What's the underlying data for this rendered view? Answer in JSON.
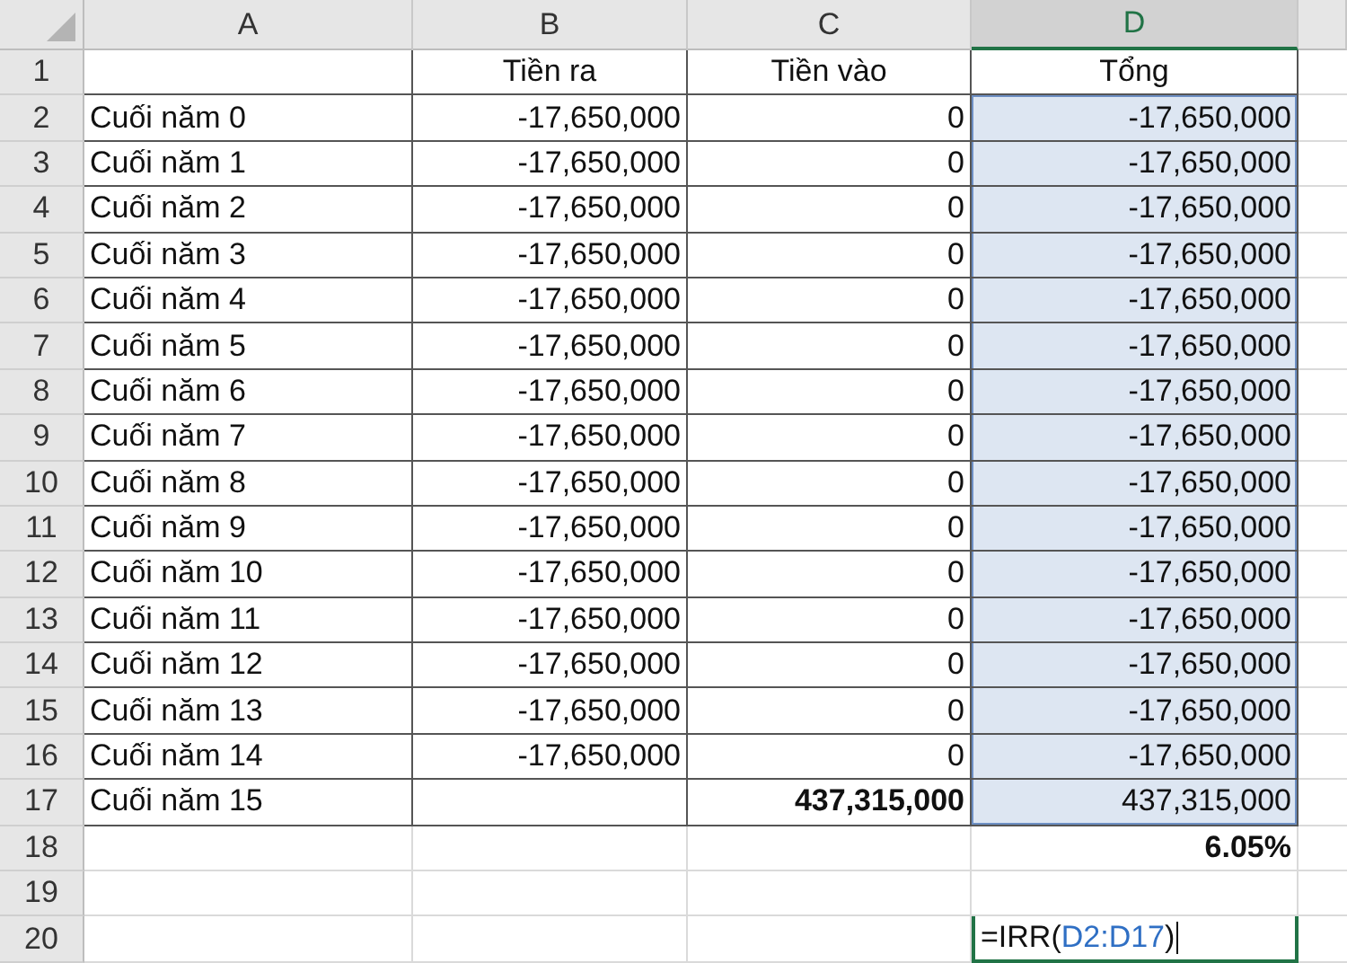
{
  "columns": [
    {
      "label": "A",
      "selected": false
    },
    {
      "label": "B",
      "selected": false
    },
    {
      "label": "C",
      "selected": false
    },
    {
      "label": "D",
      "selected": true
    }
  ],
  "rows": [
    {
      "number": "1",
      "bordered": true,
      "cells": {
        "B": {
          "text": "Tiền ra",
          "kind": "heading"
        },
        "C": {
          "text": "Tiền vào",
          "kind": "heading"
        },
        "D": {
          "text": "Tổng",
          "kind": "heading"
        }
      }
    },
    {
      "number": "2",
      "bordered": true,
      "cells": {
        "A": {
          "text": "Cuối năm 0",
          "kind": "text"
        },
        "B": {
          "text": "-17,650,000",
          "kind": "number"
        },
        "C": {
          "text": "0",
          "kind": "number"
        },
        "D": {
          "text": "-17,650,000",
          "kind": "number",
          "highlighted": true
        }
      }
    },
    {
      "number": "3",
      "bordered": true,
      "cells": {
        "A": {
          "text": "Cuối năm 1",
          "kind": "text"
        },
        "B": {
          "text": "-17,650,000",
          "kind": "number"
        },
        "C": {
          "text": "0",
          "kind": "number"
        },
        "D": {
          "text": "-17,650,000",
          "kind": "number",
          "highlighted": true
        }
      }
    },
    {
      "number": "4",
      "bordered": true,
      "cells": {
        "A": {
          "text": "Cuối năm 2",
          "kind": "text"
        },
        "B": {
          "text": "-17,650,000",
          "kind": "number"
        },
        "C": {
          "text": "0",
          "kind": "number"
        },
        "D": {
          "text": "-17,650,000",
          "kind": "number",
          "highlighted": true
        }
      }
    },
    {
      "number": "5",
      "bordered": true,
      "cells": {
        "A": {
          "text": "Cuối năm 3",
          "kind": "text"
        },
        "B": {
          "text": "-17,650,000",
          "kind": "number"
        },
        "C": {
          "text": "0",
          "kind": "number"
        },
        "D": {
          "text": "-17,650,000",
          "kind": "number",
          "highlighted": true
        }
      }
    },
    {
      "number": "6",
      "bordered": true,
      "cells": {
        "A": {
          "text": "Cuối năm 4",
          "kind": "text"
        },
        "B": {
          "text": "-17,650,000",
          "kind": "number"
        },
        "C": {
          "text": "0",
          "kind": "number"
        },
        "D": {
          "text": "-17,650,000",
          "kind": "number",
          "highlighted": true
        }
      }
    },
    {
      "number": "7",
      "bordered": true,
      "cells": {
        "A": {
          "text": "Cuối năm 5",
          "kind": "text"
        },
        "B": {
          "text": "-17,650,000",
          "kind": "number"
        },
        "C": {
          "text": "0",
          "kind": "number"
        },
        "D": {
          "text": "-17,650,000",
          "kind": "number",
          "highlighted": true
        }
      }
    },
    {
      "number": "8",
      "bordered": true,
      "cells": {
        "A": {
          "text": "Cuối năm 6",
          "kind": "text"
        },
        "B": {
          "text": "-17,650,000",
          "kind": "number"
        },
        "C": {
          "text": "0",
          "kind": "number"
        },
        "D": {
          "text": "-17,650,000",
          "kind": "number",
          "highlighted": true
        }
      }
    },
    {
      "number": "9",
      "bordered": true,
      "cells": {
        "A": {
          "text": "Cuối năm 7",
          "kind": "text"
        },
        "B": {
          "text": "-17,650,000",
          "kind": "number"
        },
        "C": {
          "text": "0",
          "kind": "number"
        },
        "D": {
          "text": "-17,650,000",
          "kind": "number",
          "highlighted": true
        }
      }
    },
    {
      "number": "10",
      "bordered": true,
      "cells": {
        "A": {
          "text": "Cuối năm 8",
          "kind": "text"
        },
        "B": {
          "text": "-17,650,000",
          "kind": "number"
        },
        "C": {
          "text": "0",
          "kind": "number"
        },
        "D": {
          "text": "-17,650,000",
          "kind": "number",
          "highlighted": true
        }
      }
    },
    {
      "number": "11",
      "bordered": true,
      "cells": {
        "A": {
          "text": "Cuối năm 9",
          "kind": "text"
        },
        "B": {
          "text": "-17,650,000",
          "kind": "number"
        },
        "C": {
          "text": "0",
          "kind": "number"
        },
        "D": {
          "text": "-17,650,000",
          "kind": "number",
          "highlighted": true
        }
      }
    },
    {
      "number": "12",
      "bordered": true,
      "cells": {
        "A": {
          "text": "Cuối năm 10",
          "kind": "text"
        },
        "B": {
          "text": "-17,650,000",
          "kind": "number"
        },
        "C": {
          "text": "0",
          "kind": "number"
        },
        "D": {
          "text": "-17,650,000",
          "kind": "number",
          "highlighted": true
        }
      }
    },
    {
      "number": "13",
      "bordered": true,
      "cells": {
        "A": {
          "text": "Cuối năm 11",
          "kind": "text"
        },
        "B": {
          "text": "-17,650,000",
          "kind": "number"
        },
        "C": {
          "text": "0",
          "kind": "number"
        },
        "D": {
          "text": "-17,650,000",
          "kind": "number",
          "highlighted": true
        }
      }
    },
    {
      "number": "14",
      "bordered": true,
      "cells": {
        "A": {
          "text": "Cuối năm 12",
          "kind": "text"
        },
        "B": {
          "text": "-17,650,000",
          "kind": "number"
        },
        "C": {
          "text": "0",
          "kind": "number"
        },
        "D": {
          "text": "-17,650,000",
          "kind": "number",
          "highlighted": true
        }
      }
    },
    {
      "number": "15",
      "bordered": true,
      "cells": {
        "A": {
          "text": "Cuối năm 13",
          "kind": "text"
        },
        "B": {
          "text": "-17,650,000",
          "kind": "number"
        },
        "C": {
          "text": "0",
          "kind": "number"
        },
        "D": {
          "text": "-17,650,000",
          "kind": "number",
          "highlighted": true
        }
      }
    },
    {
      "number": "16",
      "bordered": true,
      "cells": {
        "A": {
          "text": "Cuối năm 14",
          "kind": "text"
        },
        "B": {
          "text": "-17,650,000",
          "kind": "number"
        },
        "C": {
          "text": "0",
          "kind": "number"
        },
        "D": {
          "text": "-17,650,000",
          "kind": "number",
          "highlighted": true
        }
      }
    },
    {
      "number": "17",
      "bordered": true,
      "cells": {
        "A": {
          "text": "Cuối năm 15",
          "kind": "text"
        },
        "C": {
          "text": "437,315,000",
          "kind": "number",
          "bold": true
        },
        "D": {
          "text": "437,315,000",
          "kind": "number",
          "highlighted": true
        }
      }
    },
    {
      "number": "18",
      "bordered": false,
      "cells": {
        "D": {
          "text": "6.05%",
          "kind": "number",
          "bold": true
        }
      }
    },
    {
      "number": "19",
      "bordered": false,
      "cells": {}
    },
    {
      "number": "20",
      "bordered": false,
      "cells": {
        "D": {
          "kind": "formula",
          "parts": [
            {
              "text": "=IRR(",
              "kind": "plain"
            },
            {
              "text": "D2:D17",
              "kind": "reference"
            },
            {
              "text": ")",
              "kind": "plain"
            }
          ]
        }
      }
    }
  ]
}
